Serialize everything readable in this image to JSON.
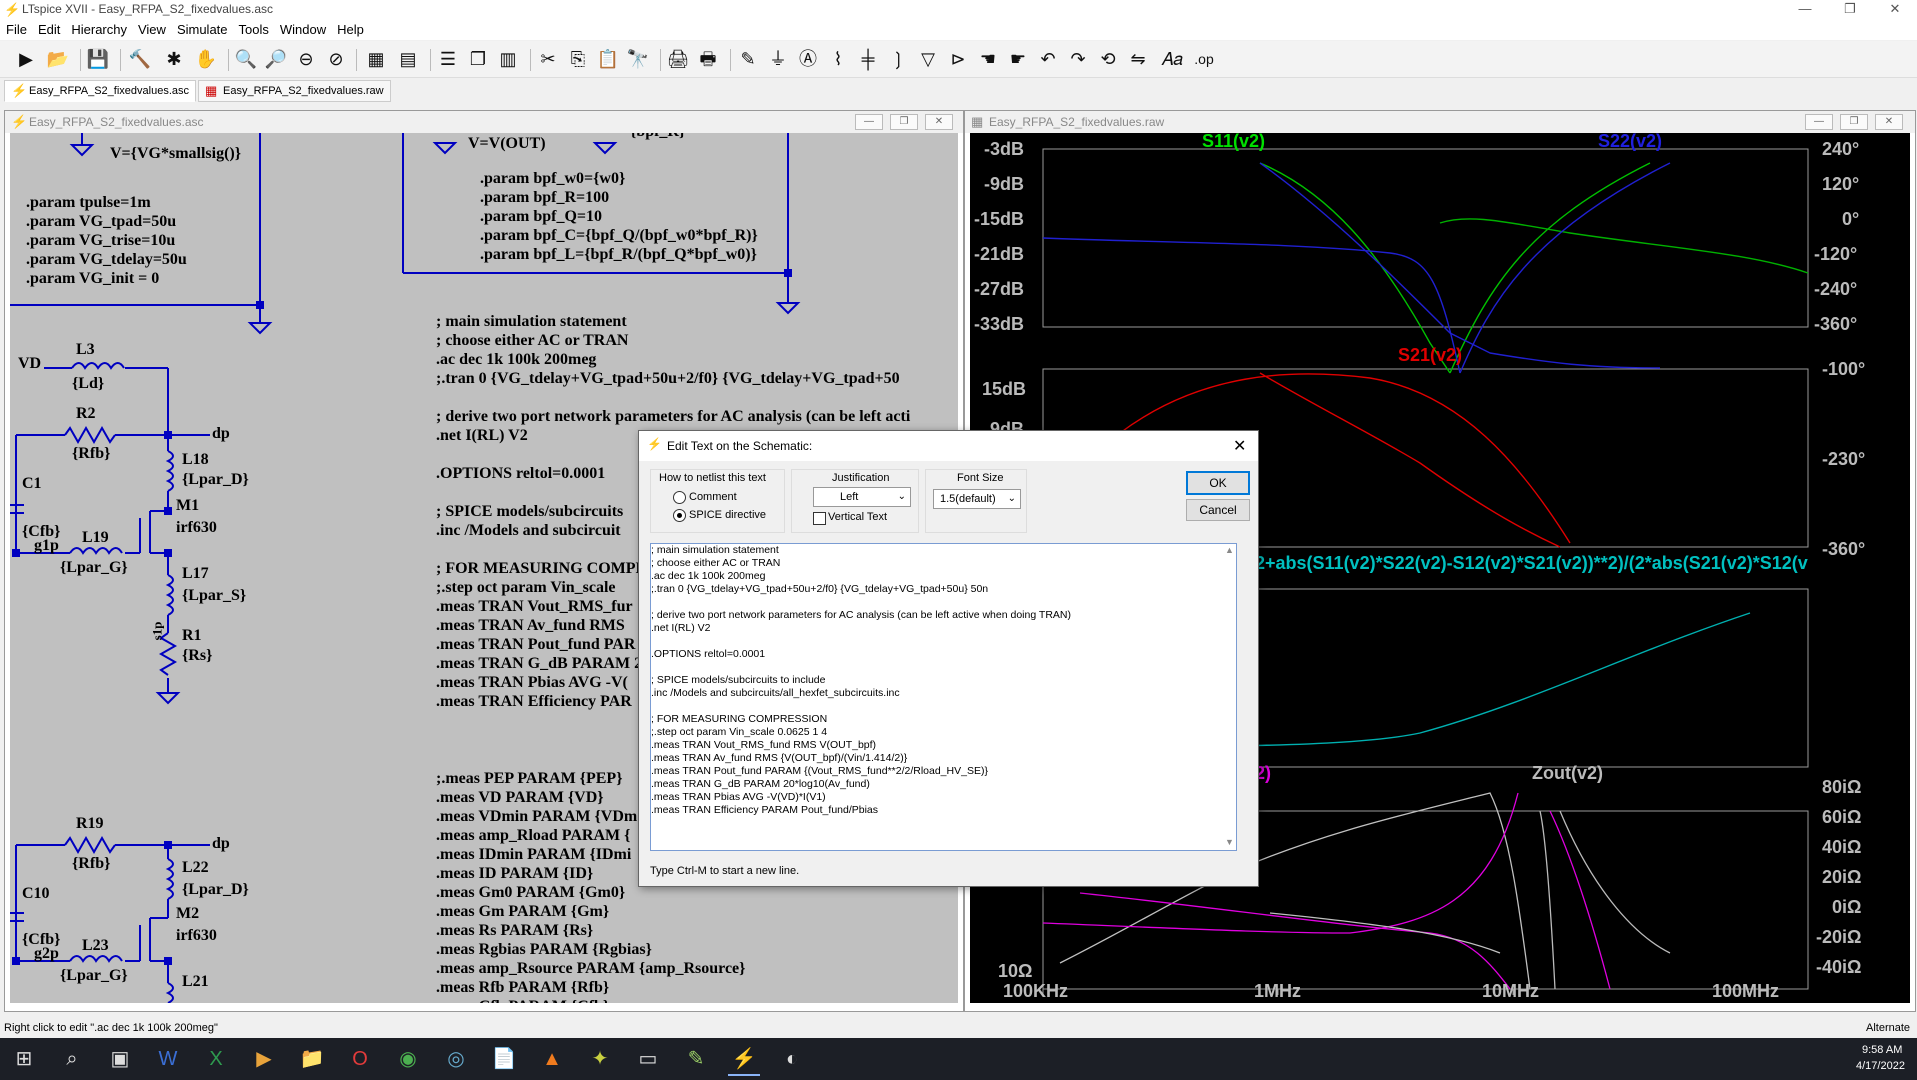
{
  "window": {
    "title": "LTspice XVII - Easy_RFPA_S2_fixedvalues.asc",
    "controls": [
      "—",
      "❐",
      "✕"
    ]
  },
  "menu": [
    "File",
    "Edit",
    "Hierarchy",
    "View",
    "Simulate",
    "Tools",
    "Window",
    "Help"
  ],
  "tabs": [
    {
      "label": "Easy_RFPA_S2_fixedvalues.asc",
      "active": true
    },
    {
      "label": "Easy_RFPA_S2_fixedvalues.raw",
      "active": false
    }
  ],
  "schematic_window": {
    "title": "Easy_RFPA_S2_fixedvalues.asc"
  },
  "plot_window": {
    "title": "Easy_RFPA_S2_fixedvalues.raw"
  },
  "schematic": {
    "top_left_source": "V={VG*smallsig()}",
    "top_mid_source": "V=V(OUT)",
    "top_mid_partial": "{bpf_R}",
    "params_left": [
      ".param tpulse=1m",
      ".param VG_tpad=50u",
      ".param VG_trise=10u",
      ".param VG_tdelay=50u",
      ".param VG_init = 0"
    ],
    "params_bpf": [
      ".param bpf_w0={w0}",
      ".param bpf_R=100",
      ".param bpf_Q=10",
      ".param bpf_C={bpf_Q/(bpf_w0*bpf_R)}",
      ".param bpf_L={bpf_R/(bpf_Q*bpf_w0)}"
    ],
    "directives": [
      "; main simulation statement",
      "; choose either AC or TRAN",
      ".ac dec 1k 100k 200meg",
      ";.tran 0 {VG_tdelay+VG_tpad+50u+2/f0} {VG_tdelay+VG_tpad+50",
      "",
      "; derive two port network parameters for AC analysis (can be left acti",
      ".net I(RL) V2",
      "",
      ".OPTIONS reltol=0.0001",
      "",
      "; SPICE models/subcircuits",
      ".inc /Models and subcircuit",
      "",
      "; FOR MEASURING COMPRI",
      ";.step oct param Vin_scale",
      ".meas TRAN Vout_RMS_fur",
      ".meas TRAN Av_fund RMS",
      ".meas TRAN Pout_fund PAR",
      ".meas TRAN G_dB PARAM 2",
      ".meas TRAN Pbias AVG -V(",
      ".meas TRAN Efficiency PAR"
    ],
    "meas_list": [
      ";.meas PEP PARAM {PEP}",
      ".meas VD PARAM {VD}",
      ".meas VDmin PARAM {VDm",
      ".meas amp_Rload PARAM {",
      ".meas IDmin PARAM {IDmi",
      ".meas ID PARAM {ID}",
      ".meas Gm0 PARAM {Gm0}",
      ".meas Gm PARAM {Gm}",
      ".meas Rs PARAM {Rs}",
      ".meas Rgbias PARAM {Rgbias}",
      ".meas amp_Rsource PARAM {amp_Rsource}",
      ".meas Rfb PARAM {Rfb}",
      ".meas Cfb PARAM {Cfb}"
    ],
    "components": {
      "VD": "VD",
      "L3": "L3",
      "Ld": "{Ld}",
      "R2": "R2",
      "Rfb": "{Rfb}",
      "dp": "dp",
      "L18": "L18",
      "Lpar_D": "{Lpar_D}",
      "C1": "C1",
      "Cfb": "{Cfb}",
      "M1": "M1",
      "g1p": "g1p",
      "L19": "L19",
      "irf630": "irf630",
      "Lpar_G": "{Lpar_G}",
      "L17": "L17",
      "Lpar_S": "{Lpar_S}",
      "s1p": "s1p",
      "R1": "R1",
      "Rs": "{Rs}",
      "R19": "R19",
      "Rfb2": "{Rfb}",
      "dp2": "dp",
      "L22": "L22",
      "Lpar_D2": "{Lpar_D}",
      "C10": "C10",
      "Cfb2": "{Cfb}",
      "M2": "M2",
      "g2p": "g2p",
      "L23": "L23",
      "irf630_2": "irf630",
      "Lpar_G2": "{Lpar_G}",
      "L21": "L21"
    }
  },
  "plot": {
    "pane1": {
      "traces": [
        {
          "name": "S11(v2)",
          "color": "#00e000"
        },
        {
          "name": "S22(v2)",
          "color": "#2020e0"
        }
      ],
      "left_ticks": [
        "-3dB",
        "-9dB",
        "-15dB",
        "-21dB",
        "-27dB",
        "-33dB"
      ],
      "right_ticks": [
        "240°",
        "120°",
        "0°",
        "-120°",
        "-240°",
        "-360°"
      ]
    },
    "pane2": {
      "traces": [
        {
          "name": "S21(v2)",
          "color": "#e00000"
        }
      ],
      "left_ticks": [
        "15dB",
        "9dB"
      ],
      "right_ticks": [
        "-100°",
        "-230°",
        "-360°"
      ]
    },
    "pane3": {
      "traces": [
        {
          "name": "2+abs(S11(v2)*S22(v2)-S12(v2)*S21(v2))**2)/(2*abs(S21(v2)*S12(v",
          "color": "#00c0c0"
        }
      ]
    },
    "pane4": {
      "traces": [
        {
          "name": "Zout(v2)",
          "color": "#bbbbbb"
        },
        {
          "name": "2)",
          "color": "#e000e0"
        }
      ],
      "left_ticks": [
        "10Ω"
      ],
      "right_ticks": [
        "80iΩ",
        "60iΩ",
        "40iΩ",
        "20iΩ",
        "0iΩ",
        "-20iΩ",
        "-40iΩ"
      ]
    },
    "x_ticks": [
      "100KHz",
      "1MHz",
      "10MHz",
      "100MHz"
    ]
  },
  "dialog": {
    "title": "Edit Text on the Schematic:",
    "netlist_group": "How to netlist this text",
    "radio_comment": "Comment",
    "radio_spice": "SPICE directive",
    "justification_label": "Justification",
    "justification_value": "Left",
    "vertical_text": "Vertical Text",
    "font_size_label": "Font Size",
    "font_size_value": "1.5(default)",
    "ok": "OK",
    "cancel": "Cancel",
    "hint": "Type Ctrl-M to start a new line.",
    "text": "; main simulation statement\n; choose either AC or TRAN\n.ac dec 1k 100k 200meg\n;.tran 0 {VG_tdelay+VG_tpad+50u+2/f0} {VG_tdelay+VG_tpad+50u} 50n\n\n; derive two port network parameters for AC analysis (can be left active when doing TRAN)\n.net I(RL) V2\n\n.OPTIONS reltol=0.0001\n\n; SPICE models/subcircuits to include\n.inc /Models and subcircuits/all_hexfet_subcircuits.inc\n\n; FOR MEASURING COMPRESSION\n;.step oct param Vin_scale 0.0625 1 4\n.meas TRAN Vout_RMS_fund RMS V(OUT_bpf)\n.meas TRAN Av_fund RMS {V(OUT_bpf)/(Vin/1.414/2)}\n.meas TRAN Pout_fund PARAM {(Vout_RMS_fund**2/2/Rload_HV_SE)}\n.meas TRAN G_dB PARAM 20*log10(Av_fund)\n.meas TRAN Pbias AVG -V(VD)*I(V1)\n.meas TRAN Efficiency PARAM Pout_fund/Pbias"
  },
  "statusbar": {
    "left": "Right click to edit \".ac dec 1k 100k 200meg\"",
    "right": "Alternate"
  },
  "taskbar": {
    "time": "9:58 AM",
    "date": "4/17/2022"
  }
}
